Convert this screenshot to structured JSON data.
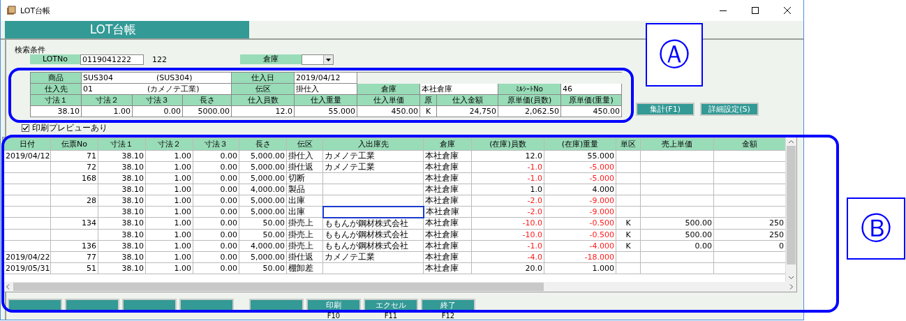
{
  "window": {
    "title": "LOT台帳"
  },
  "header": {
    "title": "LOT台帳"
  },
  "search": {
    "section_label": "検索条件",
    "lot_label": "LOTNo",
    "lot_value": "0119041222",
    "lot_count": "122",
    "warehouse_label": "倉庫"
  },
  "info": {
    "product_label": "商品",
    "product_code": "SUS304",
    "product_name": "(SUS304)",
    "purchase_date_label": "仕入日",
    "purchase_date": "2019/04/12",
    "supplier_label": "仕入先",
    "supplier_code": "01",
    "supplier_name": "(カメノテ工業)",
    "slip_type_label": "伝区",
    "slip_type": "掛仕入",
    "warehouse_label": "倉庫",
    "warehouse": "本社倉庫",
    "millsheet_label": "ﾐﾙｼｰﾄNo",
    "millsheet_no": "46",
    "columns": [
      "寸法１",
      "寸法２",
      "寸法３",
      "長さ",
      "仕入員数",
      "仕入重量",
      "仕入単価",
      "原",
      "仕入金額",
      "原単価(員数)",
      "原単価(重量)"
    ],
    "values": [
      "38.10",
      "1.00",
      "0.00",
      "5000.00",
      "12.0",
      "55.000",
      "450.00",
      "K",
      "24,750",
      "2,062.50",
      "450.00"
    ]
  },
  "actions": [
    {
      "label": "集計(F1)"
    },
    {
      "label": "詳細設定(S)"
    }
  ],
  "print_preview": {
    "label": "印刷プレビューあり",
    "checked": true
  },
  "grid": {
    "columns": [
      "日付",
      "伝票No",
      "寸法１",
      "寸法２",
      "寸法３",
      "長さ",
      "伝区",
      "入出庫先",
      "倉庫",
      "(在庫)員数",
      "(在庫)重量",
      "単区",
      "売上単価",
      "金額"
    ],
    "rows": [
      {
        "date": "2019/04/12",
        "slip_no": "71",
        "dim1": "38.10",
        "dim2": "1.00",
        "dim3": "0.00",
        "length": "5,000.00",
        "slip_type": "掛仕入",
        "destination": "カメノテ工業",
        "warehouse": "本社倉庫",
        "qty": "12.0",
        "weight": "55.000",
        "negative": false,
        "focused": false
      },
      {
        "slip_no": "72",
        "dim1": "38.10",
        "dim2": "1.00",
        "dim3": "0.00",
        "length": "5,000.00",
        "slip_type": "掛仕返",
        "destination": "カメノテ工業",
        "warehouse": "本社倉庫",
        "qty": "-1.0",
        "weight": "-5.000",
        "negative": true,
        "focused": false
      },
      {
        "slip_no": "168",
        "dim1": "38.10",
        "dim2": "1.00",
        "dim3": "0.00",
        "length": "5,000.00",
        "slip_type": "切断",
        "warehouse": "本社倉庫",
        "qty": "-1.0",
        "weight": "-5.000",
        "negative": true,
        "focused": false
      },
      {
        "dim1": "38.10",
        "dim2": "1.00",
        "dim3": "0.00",
        "length": "4,000.00",
        "slip_type": "製品",
        "warehouse": "本社倉庫",
        "qty": "1.0",
        "weight": "4.000",
        "negative": false,
        "focused": false
      },
      {
        "slip_no": "28",
        "dim1": "38.10",
        "dim2": "1.00",
        "dim3": "0.00",
        "length": "5,000.00",
        "slip_type": "出庫",
        "warehouse": "本社倉庫",
        "qty": "-2.0",
        "weight": "-9.000",
        "negative": true,
        "focused": false
      },
      {
        "dim1": "38.10",
        "dim2": "1.00",
        "dim3": "0.00",
        "length": "5,000.00",
        "slip_type": "出庫",
        "warehouse": "本社倉庫",
        "qty": "-2.0",
        "weight": "-9.000",
        "negative": true,
        "focused": true
      },
      {
        "slip_no": "134",
        "dim1": "38.10",
        "dim2": "1.00",
        "dim3": "0.00",
        "length": "50.00",
        "slip_type": "掛売上",
        "destination": "ももんが鋼材株式会社",
        "warehouse": "本社倉庫",
        "qty": "-10.0",
        "weight": "-0.500",
        "unit_type": "K",
        "unit_price": "500.00",
        "amount": "250",
        "negative": true,
        "focused": false
      },
      {
        "dim1": "38.10",
        "dim2": "1.00",
        "dim3": "0.00",
        "length": "50.00",
        "slip_type": "掛売上",
        "destination": "ももんが鋼材株式会社",
        "warehouse": "本社倉庫",
        "qty": "-10.0",
        "weight": "-0.500",
        "unit_type": "K",
        "unit_price": "500.00",
        "amount": "250",
        "negative": true,
        "focused": false
      },
      {
        "slip_no": "136",
        "dim1": "38.10",
        "dim2": "1.00",
        "dim3": "0.00",
        "length": "4,000.00",
        "slip_type": "掛売上",
        "destination": "ももんが鋼材株式会社",
        "warehouse": "本社倉庫",
        "qty": "-1.0",
        "weight": "-4.000",
        "unit_type": "K",
        "unit_price": "0.00",
        "amount": "0",
        "negative": true,
        "focused": false
      },
      {
        "date": "2019/04/22",
        "slip_no": "77",
        "dim1": "38.10",
        "dim2": "1.00",
        "dim3": "0.00",
        "length": "5,000.00",
        "slip_type": "掛仕返",
        "destination": "カメノテ工業",
        "warehouse": "本社倉庫",
        "qty": "-4.0",
        "weight": "-18.000",
        "negative": true,
        "focused": false
      },
      {
        "date": "2019/05/31",
        "slip_no": "51",
        "dim1": "38.10",
        "dim2": "1.00",
        "dim3": "0.00",
        "length": "50.00",
        "slip_type": "棚卸差",
        "warehouse": "本社倉庫",
        "qty": "20.0",
        "weight": "1.000",
        "negative": false,
        "focused": false
      }
    ]
  },
  "function_keys": [
    {
      "buttons": [
        {
          "kind": "blank"
        },
        {
          "kind": "blank"
        },
        {
          "kind": "blank"
        },
        {
          "kind": "blank"
        }
      ]
    },
    {
      "buttons": [
        {
          "kind": "blank"
        },
        {
          "kind": "labeled",
          "label": "印刷",
          "fkey": "F10"
        },
        {
          "kind": "labeled",
          "label": "エクセル",
          "fkey": "F11"
        },
        {
          "kind": "labeled",
          "label": "終了",
          "fkey": "F12"
        }
      ]
    }
  ],
  "annotations": [
    {
      "kind": "label",
      "text": "Ⓐ"
    },
    {
      "kind": "frame"
    },
    {
      "kind": "frame"
    },
    {
      "kind": "label",
      "text": "Ⓑ"
    }
  ]
}
